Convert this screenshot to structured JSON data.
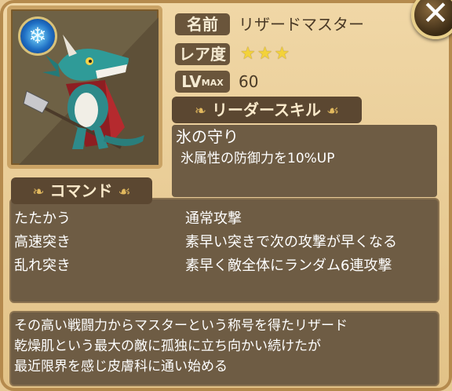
{
  "unit": {
    "name_label": "名前",
    "name": "リザードマスター",
    "rarity_label": "レア度",
    "rarity_stars": 3,
    "rarity_max": 3,
    "level_label": "LV",
    "level_max_tag": "MAX",
    "level": "60",
    "element_icon": "ice-element-icon"
  },
  "leader_skill": {
    "header": "リーダースキル",
    "name": "氷の守り",
    "description": "氷属性の防御力を10%UP"
  },
  "commands": {
    "header": "コマンド",
    "items": [
      {
        "name": "たたかう",
        "description": "通常攻撃"
      },
      {
        "name": "高速突き",
        "description": "素早い突きで次の攻撃が早くなる"
      },
      {
        "name": "乱れ突き",
        "description": "素早く敵全体にランダム6連攻撃"
      }
    ]
  },
  "flavor_text": [
    "その高い戦闘力からマスターという称号を得たリザード",
    "乾燥肌という最大の敵に孤独に立ち向かい続けたが",
    "最近限界を感じ皮膚科に通い始める"
  ],
  "colors": {
    "frame": "#e2c287",
    "panel": "#6e5c44",
    "header": "#5b4731",
    "star": "#f3d23a"
  }
}
